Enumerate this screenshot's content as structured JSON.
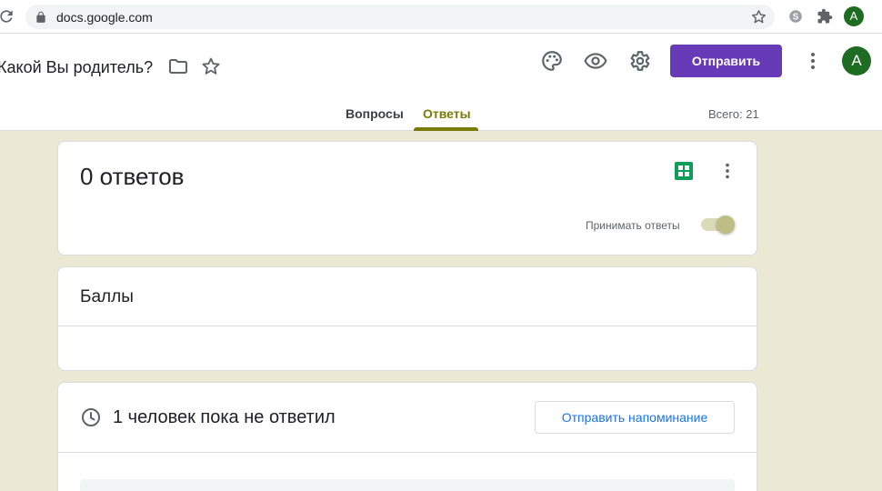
{
  "browser": {
    "url": "docs.google.com",
    "avatar_letter": "A",
    "icons": [
      "reload-icon",
      "lock-icon",
      "star-icon",
      "skype-icon",
      "extensions-icon"
    ]
  },
  "header": {
    "title": "Какой Вы родитель?",
    "send_label": "Отправить",
    "avatar_letter": "A",
    "icons": [
      "folder-icon",
      "star-icon",
      "palette-icon",
      "eye-icon",
      "gear-icon",
      "more-vert-icon"
    ]
  },
  "tabs": [
    {
      "label": "Вопросы",
      "active": false
    },
    {
      "label": "Ответы",
      "active": true
    }
  ],
  "total": "Всего: 21",
  "responses_card": {
    "count_title": "0 ответов",
    "accepting_label": "Принимать ответы",
    "accepting_on": true
  },
  "scores_card": {
    "title": "Баллы"
  },
  "pending_card": {
    "text": "1 человек пока не ответил",
    "reminder_label": "Отправить напоминание"
  },
  "colors": {
    "accent": "#673ab7",
    "theme": "#7a7a08",
    "background": "#ebe8d3",
    "avatar": "#1e6b22",
    "sheets": "#0f9d58",
    "link": "#1a73e8"
  }
}
